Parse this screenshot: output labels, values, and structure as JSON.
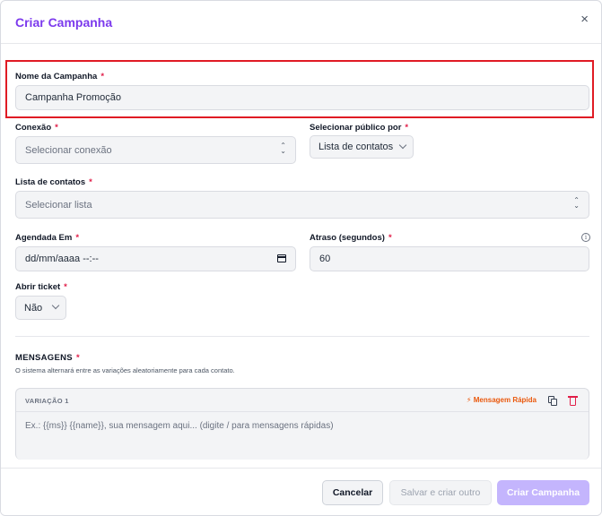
{
  "modal": {
    "title": "Criar Campanha",
    "close_symbol": "×"
  },
  "form": {
    "campaign_name": {
      "label": "Nome da Campanha",
      "required": "*",
      "value": "Campanha Promoção"
    },
    "connection": {
      "label": "Conexão",
      "required": "*",
      "placeholder": "Selecionar conexão"
    },
    "audience": {
      "label": "Selecionar público por",
      "required": "*",
      "value": "Lista de contatos"
    },
    "contact_list": {
      "label": "Lista de contatos",
      "required": "*",
      "placeholder": "Selecionar lista"
    },
    "scheduled_at": {
      "label": "Agendada Em",
      "required": "*",
      "placeholder": "dd/mm/aaaa --:--"
    },
    "delay": {
      "label": "Atraso (segundos)",
      "required": "*",
      "value": "60",
      "info_symbol": "i"
    },
    "open_ticket": {
      "label": "Abrir ticket",
      "required": "*",
      "value": "Não"
    }
  },
  "messages": {
    "title": "MENSAGENS",
    "required": "*",
    "hint": "O sistema alternará entre as variações aleatoriamente para cada contato.",
    "variations": [
      {
        "title": "VARIAÇÃO 1",
        "quick_label": "⚡ Mensagem Rápida",
        "placeholder": "Ex.: {{ms}} {{name}}, sua mensagem aqui... (digite / para mensagens rápidas)"
      }
    ]
  },
  "footer": {
    "cancel": "Cancelar",
    "save_and_create_other": "Salvar e criar outro",
    "create": "Criar Campanha"
  },
  "colors": {
    "accent": "#7c3aed",
    "highlight_border": "#e01b24",
    "required_star": "#e11d48",
    "quick_message": "#ea580c",
    "create_button_disabled": "#c4b5fd"
  }
}
